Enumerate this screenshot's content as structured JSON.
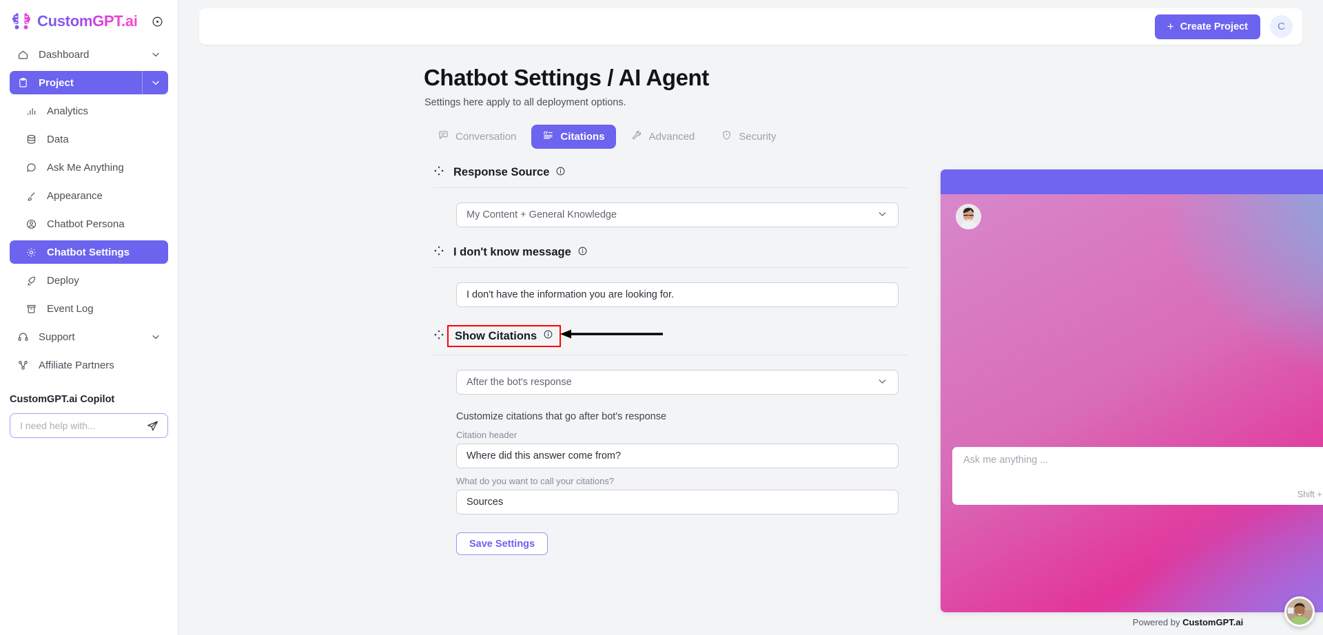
{
  "brand": {
    "name": "CustomGPT.ai",
    "toggle_icon": "circle-dot-icon"
  },
  "sidebar": {
    "items": [
      {
        "label": "Dashboard",
        "icon": "home-icon",
        "level": "top",
        "active": false,
        "chevron": true
      },
      {
        "label": "Project",
        "icon": "clipboard-icon",
        "level": "top",
        "active": true,
        "chevron": true
      },
      {
        "label": "Analytics",
        "icon": "bar-chart-icon",
        "level": "sub",
        "active": false,
        "chevron": false
      },
      {
        "label": "Data",
        "icon": "database-icon",
        "level": "sub",
        "active": false,
        "chevron": false
      },
      {
        "label": "Ask Me Anything",
        "icon": "chat-bubble-icon",
        "level": "sub",
        "active": false,
        "chevron": false
      },
      {
        "label": "Appearance",
        "icon": "paintbrush-icon",
        "level": "sub",
        "active": false,
        "chevron": false
      },
      {
        "label": "Chatbot Persona",
        "icon": "user-circle-icon",
        "level": "sub",
        "active": false,
        "chevron": false
      },
      {
        "label": "Chatbot Settings",
        "icon": "gear-icon",
        "level": "sub",
        "active": true,
        "chevron": false
      },
      {
        "label": "Deploy",
        "icon": "rocket-icon",
        "level": "sub",
        "active": false,
        "chevron": false
      },
      {
        "label": "Event Log",
        "icon": "archive-icon",
        "level": "sub",
        "active": false,
        "chevron": false
      },
      {
        "label": "Support",
        "icon": "headset-icon",
        "level": "top",
        "active": false,
        "chevron": true
      },
      {
        "label": "Affiliate Partners",
        "icon": "share-nodes-icon",
        "level": "top",
        "active": false,
        "chevron": false
      }
    ],
    "copilot": {
      "title": "CustomGPT.ai Copilot",
      "placeholder": "I need help with...",
      "value": "",
      "send_icon": "paper-plane-icon"
    }
  },
  "topbar": {
    "create_label": "Create Project",
    "plus_icon": "plus-icon",
    "avatar_initial": "C"
  },
  "page": {
    "title": "Chatbot Settings / AI Agent",
    "subtitle": "Settings here apply to all deployment options."
  },
  "tabs": [
    {
      "label": "Conversation",
      "icon": "message-square-icon",
      "active": false
    },
    {
      "label": "Citations",
      "icon": "quote-list-icon",
      "active": true
    },
    {
      "label": "Advanced",
      "icon": "wrench-icon",
      "active": false
    },
    {
      "label": "Security",
      "icon": "shield-check-icon",
      "active": false
    }
  ],
  "form": {
    "response_source": {
      "label": "Response Source",
      "info_icon": "info-icon",
      "bullet_icon": "diamond-cluster-icon",
      "selected": "My Content + General Knowledge",
      "chevron_icon": "chevron-down-icon"
    },
    "dont_know": {
      "label": "I don't know message",
      "info_icon": "info-icon",
      "bullet_icon": "diamond-cluster-icon",
      "value": "I don't have the information you are looking for."
    },
    "show_citations": {
      "label": "Show Citations",
      "info_icon": "info-icon",
      "bullet_icon": "diamond-cluster-icon",
      "highlighted": true,
      "highlight_color": "#ff0000",
      "annotation_icon": "left-arrow-annotation",
      "selected": "After the bot's response",
      "chevron_icon": "chevron-down-icon",
      "hint": "Customize citations that go after bot's response",
      "citation_header_label": "Citation header",
      "citation_header_value": "Where did this answer come from?",
      "citation_name_label": "What do you want to call your citations?",
      "citation_name_value": "Sources"
    },
    "save_label": "Save Settings"
  },
  "chat_preview": {
    "refresh_icon": "refresh-icon",
    "close_icon": "close-icon",
    "bot_avatar": "bot-avatar-photo",
    "input_placeholder": "Ask me anything ...",
    "input_value": "",
    "hint": "Shift + Enter to add a new line",
    "send_icon": "paper-plane-icon",
    "powered_prefix": "Powered by ",
    "powered_brand": "CustomGPT.ai"
  },
  "widget": {
    "avatar": "support-agent-photo"
  },
  "colors": {
    "accent_purple": "#6c63ef",
    "chat_header_purple": "#7065ef",
    "highlight_red": "#ff0000",
    "sidebar_bg": "#ffffff",
    "page_bg": "#f3f4f6"
  }
}
